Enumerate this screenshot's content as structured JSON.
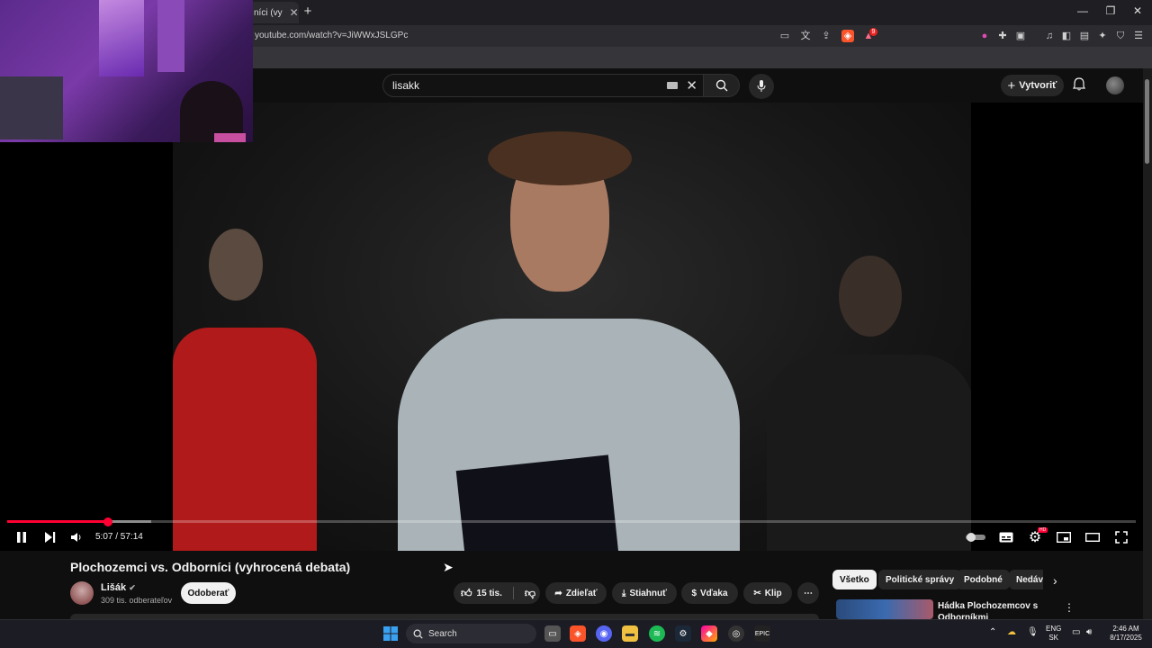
{
  "browser": {
    "tab_title": "níci (vy",
    "url": "youtube.com/watch?v=JiWWxJSLGPc",
    "window_controls": [
      "minimize",
      "restore",
      "close"
    ],
    "brave_badge": "",
    "rewards_badge": "9"
  },
  "youtube_header": {
    "search_value": "lisakk",
    "create_label": "Vytvoriť"
  },
  "player": {
    "time_current": "5:07",
    "time_total": "57:14",
    "time_display": "5:07 / 57:14",
    "progress_fraction": 0.089
  },
  "video": {
    "title": "Plochozemci vs. Odborníci (vyhrocená debata)",
    "channel_name": "Lišák",
    "subscribers": "309 tis. odberateľov",
    "subscribe_label": "Odoberať",
    "likes": "15 tis.",
    "share_label": "Zdieľať",
    "download_label": "Stiahnuť",
    "thanks_label": "Vďaka",
    "clip_label": "Klip"
  },
  "sidebar": {
    "chips": [
      "Všetko",
      "Politické správy",
      "Podobné",
      "Nedáv"
    ],
    "recommendation_title": "Hádka Plochozemcov s Odborníkmi"
  },
  "taskbar": {
    "search_placeholder": "Search",
    "lang_primary": "ENG",
    "lang_secondary": "SK",
    "clock_time": "2:46 AM",
    "clock_date": "8/17/2025"
  },
  "colors": {
    "accent_red": "#ff0033",
    "background": "#0f0f0f",
    "pill_bg": "#272727"
  }
}
